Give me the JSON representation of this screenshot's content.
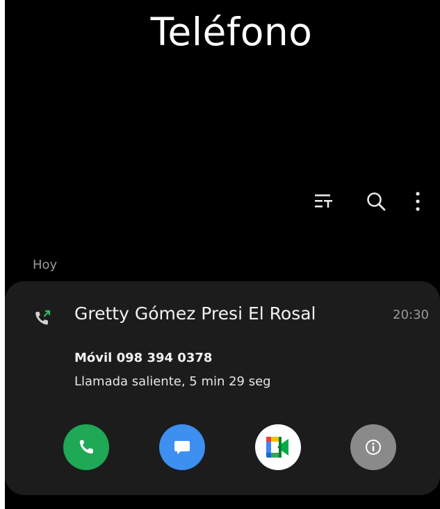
{
  "app": {
    "title": "Teléfono"
  },
  "toolbar": {
    "icons": [
      "filter-icon",
      "search-icon",
      "more-options-icon"
    ]
  },
  "call_log": {
    "section_label": "Hoy",
    "entry": {
      "call_type_icon": "outgoing-call-icon",
      "contact_name": "Gretty Gómez Presi El Rosal",
      "time": "20:30",
      "number_line": "Móvil 098 394 0378",
      "detail": "Llamada saliente, 5 min 29 seg",
      "actions": [
        {
          "name": "call-button",
          "icon": "phone-icon",
          "color": "#1fa855"
        },
        {
          "name": "message-button",
          "icon": "message-icon",
          "color": "#3d8ff0"
        },
        {
          "name": "video-call-button",
          "icon": "meet-icon",
          "color": "#ffffff"
        },
        {
          "name": "details-button",
          "icon": "info-icon",
          "color": "#8a8a8a"
        }
      ]
    }
  },
  "colors": {
    "background": "#000000",
    "card": "#1c1c1c",
    "text_primary": "#f2f2f2",
    "text_secondary": "#9a9a9a",
    "call_green": "#1fa855",
    "message_blue": "#3d8ff0",
    "info_gray": "#8a8a8a"
  }
}
